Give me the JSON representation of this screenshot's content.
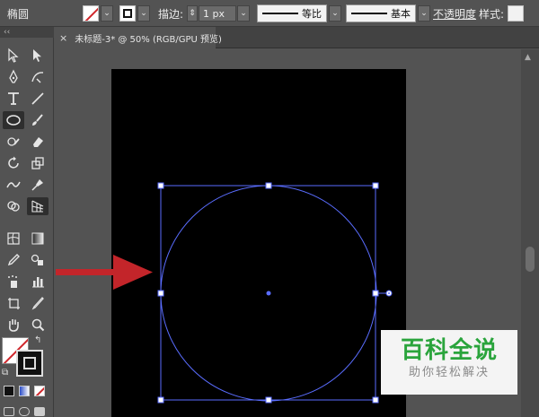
{
  "control_bar": {
    "shape_name": "椭圆",
    "stroke_label": "描边:",
    "stroke_weight": "1 px",
    "variable_width": "等比",
    "brush": "基本",
    "opacity_label": "不透明度",
    "style_label": "样式:",
    "dropdown_arrow": "⌄",
    "spinner": "⇕"
  },
  "tab": {
    "close": "×",
    "title": "未标题-3* @ 50% (RGB/GPU 预览)"
  },
  "toolbar": {
    "collapse": "‹‹",
    "color_reset": "⧉",
    "color_swap": "↰"
  },
  "scroll": {
    "up": "▲"
  },
  "watermark": {
    "main": "百科全说",
    "sub": "助你轻松解决"
  },
  "colors": {
    "accent_selection": "#5a6dff",
    "arrow": "#c3252a",
    "watermark_green": "#2aa43c"
  }
}
